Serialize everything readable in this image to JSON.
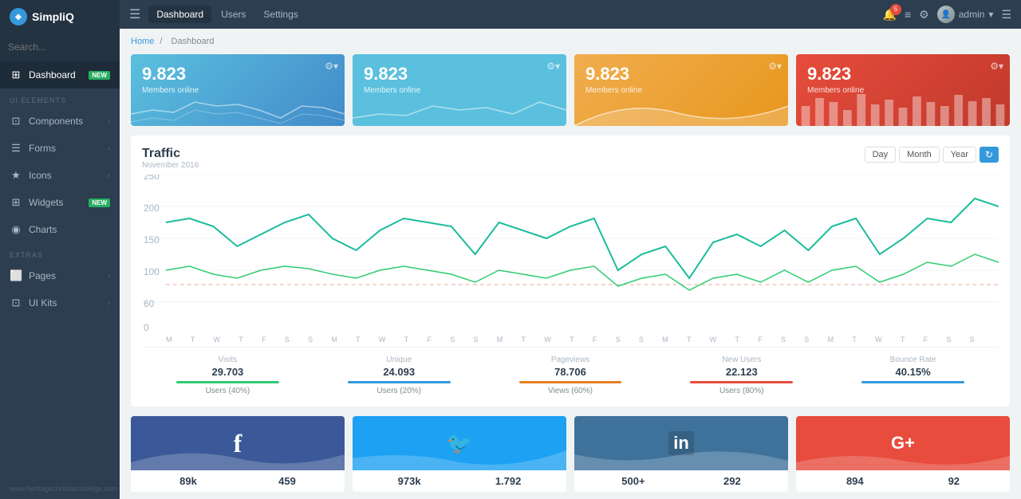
{
  "logo": {
    "text": "SimpliQ",
    "icon": "◈"
  },
  "search": {
    "placeholder": "Search..."
  },
  "sidebar": {
    "sections": [
      {
        "label": "UI ELEMENTS",
        "id": "ui-elements"
      },
      {
        "label": "EXTRAS",
        "id": "extras"
      }
    ],
    "items": [
      {
        "id": "dashboard",
        "label": "Dashboard",
        "icon": "⊞",
        "badge": "NEW",
        "active": true,
        "section": "main"
      },
      {
        "id": "components",
        "label": "Components",
        "icon": "⊡",
        "chevron": "›",
        "section": "ui"
      },
      {
        "id": "forms",
        "label": "Forms",
        "icon": "☰",
        "chevron": "›",
        "section": "ui"
      },
      {
        "id": "icons",
        "label": "Icons",
        "icon": "★",
        "chevron": "›",
        "section": "ui"
      },
      {
        "id": "widgets",
        "label": "Widgets",
        "icon": "⊞",
        "badge": "NEW",
        "section": "ui"
      },
      {
        "id": "charts",
        "label": "Charts",
        "icon": "◉",
        "section": "ui"
      },
      {
        "id": "pages",
        "label": "Pages",
        "icon": "⬜",
        "chevron": "›",
        "section": "extras"
      },
      {
        "id": "ui-kits",
        "label": "UI Kits",
        "icon": "⊡",
        "chevron": "›",
        "section": "extras"
      }
    ]
  },
  "topnav": {
    "links": [
      "Dashboard",
      "Users",
      "Settings"
    ],
    "active_link": "Dashboard",
    "notification_count": "5",
    "user": {
      "name": "admin",
      "chevron": "▾"
    }
  },
  "breadcrumb": {
    "home": "Home",
    "current": "Dashboard"
  },
  "stat_cards": [
    {
      "id": "card1",
      "number": "9.823",
      "label": "Members online",
      "color": "blue1"
    },
    {
      "id": "card2",
      "number": "9.823",
      "label": "Members online",
      "color": "blue2"
    },
    {
      "id": "card3",
      "number": "9.823",
      "label": "Members online",
      "color": "orange"
    },
    {
      "id": "card4",
      "number": "9.823",
      "label": "Members online",
      "color": "red"
    }
  ],
  "traffic": {
    "title": "Traffic",
    "subtitle": "November 2016",
    "buttons": [
      "Day",
      "Month",
      "Year"
    ],
    "active_button": "Year",
    "y_labels": [
      "250",
      "200",
      "150",
      "100",
      "60",
      "0"
    ],
    "x_labels": [
      "M",
      "T",
      "W",
      "T",
      "F",
      "S",
      "S",
      "M",
      "T",
      "W",
      "T",
      "F",
      "S",
      "S",
      "M",
      "T",
      "W",
      "T",
      "F",
      "S",
      "S",
      "M",
      "T",
      "W",
      "T",
      "F",
      "S",
      "S",
      "M",
      "T",
      "W",
      "T",
      "F",
      "S",
      "S"
    ]
  },
  "traffic_stats": [
    {
      "label": "Visits",
      "value": "29.703",
      "sub": "Users (40%)",
      "color": "#2ecc71"
    },
    {
      "label": "Unique",
      "value": "24.093",
      "sub": "Users (20%)",
      "color": "#3498db"
    },
    {
      "label": "Pageviews",
      "value": "78.706",
      "sub": "Views (60%)",
      "color": "#e67e22"
    },
    {
      "label": "New Users",
      "value": "22.123",
      "sub": "Users (80%)",
      "color": "#e74c3c"
    },
    {
      "label": "Bounce Rate",
      "value": "40.15%",
      "sub": "",
      "color": "#3498db"
    }
  ],
  "social_cards": [
    {
      "id": "facebook",
      "icon": "f",
      "class": "facebook",
      "stats": [
        {
          "value": "89k",
          "label": ""
        },
        {
          "value": "459",
          "label": ""
        }
      ]
    },
    {
      "id": "twitter",
      "icon": "🐦",
      "class": "twitter",
      "stats": [
        {
          "value": "973k",
          "label": ""
        },
        {
          "value": "1.792",
          "label": ""
        }
      ]
    },
    {
      "id": "linkedin",
      "icon": "in",
      "class": "linkedin",
      "stats": [
        {
          "value": "500+",
          "label": ""
        },
        {
          "value": "292",
          "label": ""
        }
      ]
    },
    {
      "id": "google",
      "icon": "G+",
      "class": "google",
      "stats": [
        {
          "value": "894",
          "label": ""
        },
        {
          "value": "92",
          "label": ""
        }
      ]
    }
  ],
  "sidebar_bottom": "www.heritagechristiancollege.com",
  "colors": {
    "sidebar_bg": "#2c3e50",
    "sidebar_dark": "#243342",
    "blue": "#3498db",
    "green": "#2ecc71",
    "orange": "#e67e22",
    "red": "#e74c3c"
  }
}
